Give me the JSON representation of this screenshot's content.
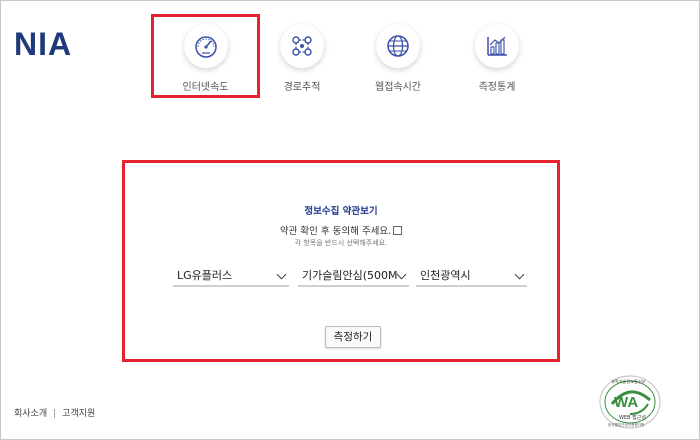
{
  "logo": "NIA",
  "menu": [
    {
      "label": "인터넷속도",
      "icon": "speedometer-icon"
    },
    {
      "label": "경로추적",
      "icon": "route-trace-icon"
    },
    {
      "label": "웹접속시간",
      "icon": "globe-icon"
    },
    {
      "label": "측정통계",
      "icon": "statistics-chart-icon"
    }
  ],
  "form": {
    "title": "정보수집 약관보기",
    "agree_label": "약관 확인 후 동의해 주세요.",
    "agree_checked": false,
    "hint": "각 항목을 반드시 선택해주세요.",
    "selects": [
      {
        "value": "LG유플러스"
      },
      {
        "value": "기가슬림안심(500M"
      },
      {
        "value": "인천광역시"
      }
    ],
    "measure_button": "측정하기"
  },
  "footer": {
    "company": "회사소개",
    "separator": "|",
    "support": "고객지원"
  },
  "badge": {
    "text_top": "과학기술정보통신부",
    "wa": "WA",
    "web": "WEB 접근성",
    "text_bottom": "한국웹접근성인증평가원"
  },
  "colors": {
    "brand": "#1f3a7a",
    "highlight": "#e6222f",
    "icon_accent": "#3b4fa8",
    "badge_green": "#3a8d3e"
  }
}
